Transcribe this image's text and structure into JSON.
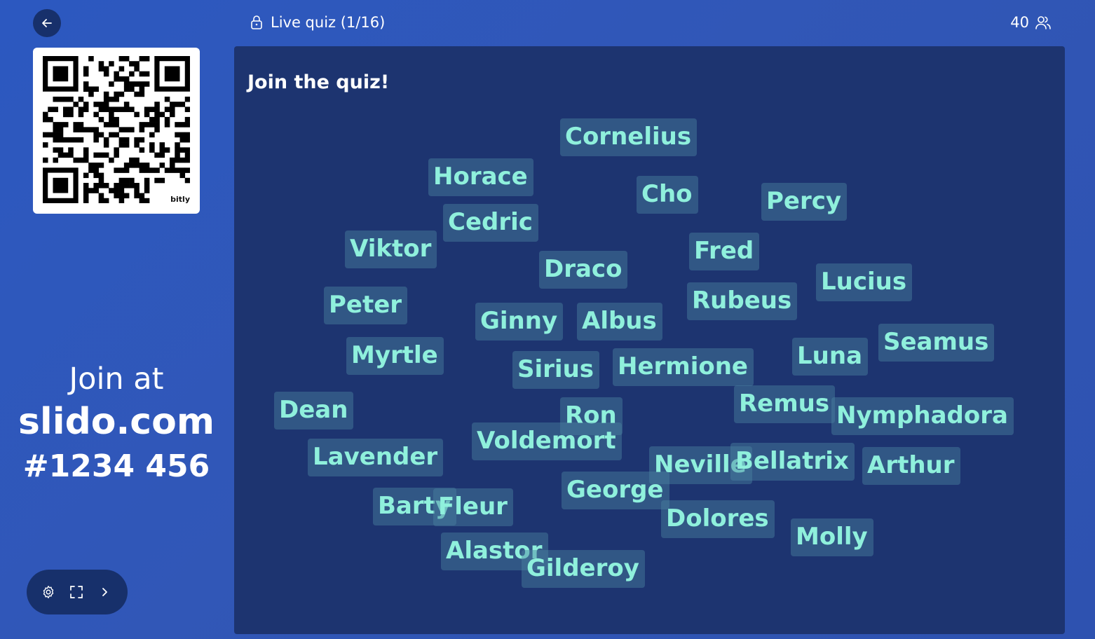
{
  "header": {
    "title": "Live quiz (1/16)",
    "participant_count": "40"
  },
  "sidebar": {
    "qr_brand": "bitly",
    "join_at": "Join at",
    "join_url": "slido.com",
    "join_code": "#1234 456"
  },
  "panel": {
    "title": "Join the quiz!"
  },
  "names": [
    "Cornelius",
    "Horace",
    "Cho",
    "Percy",
    "Cedric",
    "Viktor",
    "Fred",
    "Draco",
    "Lucius",
    "Peter",
    "Rubeus",
    "Ginny",
    "Albus",
    "Seamus",
    "Myrtle",
    "Luna",
    "Sirius",
    "Hermione",
    "Dean",
    "Remus",
    "Ron",
    "Nymphadora",
    "Voldemort",
    "Lavender",
    "Neville",
    "Bellatrix",
    "Arthur",
    "George",
    "Barty",
    "Fleur",
    "Dolores",
    "Molly",
    "Alastor",
    "Gilderoy"
  ],
  "icons": {
    "back": "arrow-left-icon",
    "lock": "lock-icon",
    "participants": "users-icon",
    "settings": "gear-icon",
    "fullscreen": "fullscreen-icon",
    "next": "chevron-right-icon"
  },
  "colors": {
    "background": "#2c58c0",
    "panel": "#1d3470",
    "name_text": "#8ff0dc",
    "control_bg": "#17306b"
  }
}
